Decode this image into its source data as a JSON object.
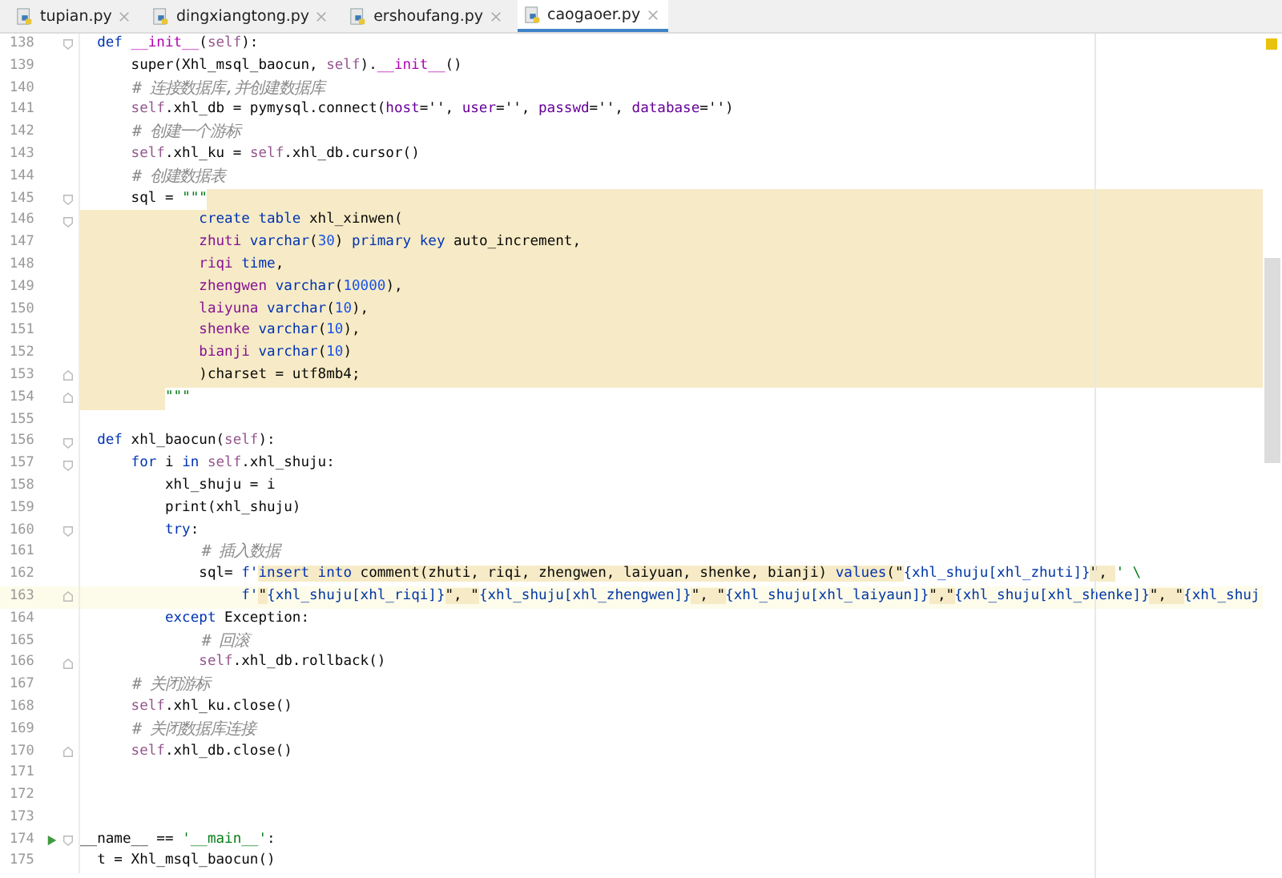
{
  "tabs": [
    {
      "label": "tupian.py",
      "selected": false
    },
    {
      "label": "dingxiangtong.py",
      "selected": false
    },
    {
      "label": "ershoufang.py",
      "selected": false
    },
    {
      "label": "caogaoer.py",
      "selected": true
    }
  ],
  "lines": [
    {
      "number": "138",
      "fold_open": true,
      "segments": [
        {
          "kind": "kw",
          "text": "  def "
        },
        {
          "kind": "dunder",
          "text": "__init__"
        },
        {
          "kind": "plain",
          "text": "("
        },
        {
          "kind": "self",
          "text": "self"
        },
        {
          "kind": "plain",
          "text": "):"
        }
      ]
    },
    {
      "number": "139",
      "segments": [
        {
          "kind": "plain",
          "text": "      super(Xhl_msql_baocun, "
        },
        {
          "kind": "self",
          "text": "self"
        },
        {
          "kind": "plain",
          "text": ")."
        },
        {
          "kind": "dunder",
          "text": "__init__"
        },
        {
          "kind": "plain",
          "text": "()"
        }
      ]
    },
    {
      "number": "140",
      "segments": [
        {
          "kind": "comment",
          "text": "      # 连接数据库,并创建数据库"
        }
      ]
    },
    {
      "number": "141",
      "segments": [
        {
          "kind": "self",
          "text": "      self"
        },
        {
          "kind": "plain",
          "text": ".xhl_db = pymysql.connect("
        },
        {
          "kind": "arg",
          "text": "host"
        },
        {
          "kind": "plain",
          "text": "='', "
        },
        {
          "kind": "arg",
          "text": "user"
        },
        {
          "kind": "plain",
          "text": "='', "
        },
        {
          "kind": "arg",
          "text": "passwd"
        },
        {
          "kind": "plain",
          "text": "='', "
        },
        {
          "kind": "arg",
          "text": "database"
        },
        {
          "kind": "plain",
          "text": "='')"
        }
      ]
    },
    {
      "number": "142",
      "segments": [
        {
          "kind": "comment",
          "text": "      # 创建一个游标"
        }
      ]
    },
    {
      "number": "143",
      "segments": [
        {
          "kind": "self",
          "text": "      self"
        },
        {
          "kind": "plain",
          "text": ".xhl_ku = "
        },
        {
          "kind": "self",
          "text": "self"
        },
        {
          "kind": "plain",
          "text": ".xhl_db.cursor()"
        }
      ]
    },
    {
      "number": "144",
      "segments": [
        {
          "kind": "comment",
          "text": "      # 创建数据表"
        }
      ]
    },
    {
      "number": "145",
      "fold_open": true,
      "fragment_after": true,
      "segments": [
        {
          "kind": "plain",
          "text": "      sql = "
        },
        {
          "kind": "string",
          "text": "\"\"\""
        }
      ]
    },
    {
      "number": "146",
      "fold_open": true,
      "fragment": true,
      "segments": [
        {
          "kind": "kw",
          "text": "              create table"
        },
        {
          "kind": "plain",
          "text": " xhl_xinwen("
        }
      ]
    },
    {
      "number": "147",
      "fragment": true,
      "segments": [
        {
          "kind": "column",
          "text": "              zhuti"
        },
        {
          "kind": "kw",
          "text": " varchar"
        },
        {
          "kind": "plain",
          "text": "("
        },
        {
          "kind": "num",
          "text": "30"
        },
        {
          "kind": "plain",
          "text": ") "
        },
        {
          "kind": "kw",
          "text": "primary key"
        },
        {
          "kind": "plain",
          "text": " auto_increment,"
        }
      ]
    },
    {
      "number": "148",
      "fragment": true,
      "segments": [
        {
          "kind": "column",
          "text": "              riqi"
        },
        {
          "kind": "kw",
          "text": " time"
        },
        {
          "kind": "plain",
          "text": ","
        }
      ]
    },
    {
      "number": "149",
      "fragment": true,
      "segments": [
        {
          "kind": "column",
          "text": "              zhengwen"
        },
        {
          "kind": "kw",
          "text": " varchar"
        },
        {
          "kind": "plain",
          "text": "("
        },
        {
          "kind": "num",
          "text": "10000"
        },
        {
          "kind": "plain",
          "text": "),"
        }
      ]
    },
    {
      "number": "150",
      "fragment": true,
      "segments": [
        {
          "kind": "column",
          "text": "              laiyuna"
        },
        {
          "kind": "kw",
          "text": " varchar"
        },
        {
          "kind": "plain",
          "text": "("
        },
        {
          "kind": "num",
          "text": "10"
        },
        {
          "kind": "plain",
          "text": "),"
        }
      ]
    },
    {
      "number": "151",
      "fragment": true,
      "segments": [
        {
          "kind": "column",
          "text": "              shenke"
        },
        {
          "kind": "kw",
          "text": " varchar"
        },
        {
          "kind": "plain",
          "text": "("
        },
        {
          "kind": "num",
          "text": "10"
        },
        {
          "kind": "plain",
          "text": "),"
        }
      ]
    },
    {
      "number": "152",
      "fragment": true,
      "segments": [
        {
          "kind": "column",
          "text": "              bianji"
        },
        {
          "kind": "kw",
          "text": " varchar"
        },
        {
          "kind": "plain",
          "text": "("
        },
        {
          "kind": "num",
          "text": "10"
        },
        {
          "kind": "plain",
          "text": ")"
        }
      ]
    },
    {
      "number": "153",
      "fold_close": true,
      "fragment": true,
      "segments": [
        {
          "kind": "plain",
          "text": "              )charset = utf8mb4;"
        }
      ]
    },
    {
      "number": "154",
      "fold_close": true,
      "fragment_before": true,
      "segments": [
        {
          "kind": "string",
          "text": "\"\"\""
        }
      ]
    },
    {
      "number": "155"
    },
    {
      "number": "156",
      "fold_open": true,
      "segments": [
        {
          "kind": "kw",
          "text": "  def"
        },
        {
          "kind": "plain",
          "text": " xhl_baocun("
        },
        {
          "kind": "self",
          "text": "self"
        },
        {
          "kind": "plain",
          "text": "):"
        }
      ]
    },
    {
      "number": "157",
      "fold_open": true,
      "segments": [
        {
          "kind": "kw",
          "text": "      for"
        },
        {
          "kind": "plain",
          "text": " i "
        },
        {
          "kind": "kw",
          "text": "in"
        },
        {
          "kind": "self",
          "text": " self"
        },
        {
          "kind": "plain",
          "text": ".xhl_shuju:"
        }
      ]
    },
    {
      "number": "158",
      "segments": [
        {
          "kind": "plain",
          "text": "          xhl_shuju = i"
        }
      ]
    },
    {
      "number": "159",
      "segments": [
        {
          "kind": "plain",
          "text": "          print(xhl_shuju)"
        }
      ]
    },
    {
      "number": "160",
      "fold_open": true,
      "segments": [
        {
          "kind": "kw",
          "text": "          try"
        },
        {
          "kind": "plain",
          "text": ":"
        }
      ]
    },
    {
      "number": "161",
      "segments": [
        {
          "kind": "comment",
          "text": "              # 插入数据"
        }
      ]
    },
    {
      "number": "162",
      "segments": [
        {
          "kind": "plain",
          "text": "              sql= "
        },
        {
          "kind": "kw",
          "text": "f'"
        },
        {
          "kind": "kw",
          "text": "insert into",
          "injected": true
        },
        {
          "kind": "plain",
          "text": " comment(zhuti, riqi, zhengwen, laiyuan, shenke, bianji) ",
          "injected": true
        },
        {
          "kind": "kw",
          "text": "values",
          "injected": true
        },
        {
          "kind": "plain",
          "text": "(\"",
          "injected": true
        },
        {
          "kind": "fx",
          "text": "{xhl_shuju[xhl_zhuti]}"
        },
        {
          "kind": "plain",
          "text": "\", ",
          "injected": true
        },
        {
          "kind": "string",
          "text": "' \\"
        }
      ]
    },
    {
      "number": "163",
      "fold_close": true,
      "current": true,
      "segments": [
        {
          "kind": "kw",
          "text": "                   f'"
        },
        {
          "kind": "plain",
          "text": "\"",
          "injected": true
        },
        {
          "kind": "fx",
          "text": "{xhl_shuju[xhl_riqi]}"
        },
        {
          "kind": "plain",
          "text": "\", \"",
          "injected": true
        },
        {
          "kind": "fx",
          "text": "{xhl_shuju[xhl_zhengwen]}"
        },
        {
          "kind": "plain",
          "text": "\", \"",
          "injected": true
        },
        {
          "kind": "fx",
          "text": "{xhl_shuju[xhl_laiyaun]}"
        },
        {
          "kind": "plain",
          "text": "\",\"",
          "injected": true
        },
        {
          "kind": "fx",
          "text": "{xhl_shuju[xhl_shenke]}"
        },
        {
          "kind": "plain",
          "text": "\", \"",
          "injected": true
        },
        {
          "kind": "fx",
          "text": "{xhl_shuj"
        }
      ]
    },
    {
      "number": "164",
      "segments": [
        {
          "kind": "kw",
          "text": "          except"
        },
        {
          "kind": "plain",
          "text": " Exception:"
        }
      ]
    },
    {
      "number": "165",
      "segments": [
        {
          "kind": "comment",
          "text": "              # 回滚"
        }
      ]
    },
    {
      "number": "166",
      "fold_close": true,
      "segments": [
        {
          "kind": "self",
          "text": "              self"
        },
        {
          "kind": "plain",
          "text": ".xhl_db.rollback()"
        }
      ]
    },
    {
      "number": "167",
      "segments": [
        {
          "kind": "comment",
          "text": "      # 关闭游标"
        }
      ]
    },
    {
      "number": "168",
      "segments": [
        {
          "kind": "self",
          "text": "      self"
        },
        {
          "kind": "plain",
          "text": ".xhl_ku.close()"
        }
      ]
    },
    {
      "number": "169",
      "segments": [
        {
          "kind": "comment",
          "text": "      # 关闭数据库连接"
        }
      ]
    },
    {
      "number": "170",
      "fold_close": true,
      "segments": [
        {
          "kind": "self",
          "text": "      self"
        },
        {
          "kind": "plain",
          "text": ".xhl_db.close()"
        }
      ]
    },
    {
      "number": "171"
    },
    {
      "number": "172"
    },
    {
      "number": "173"
    },
    {
      "number": "174",
      "fold_open": true,
      "runnable": true,
      "segments": [
        {
          "kind": "plain",
          "text": "__name__ == "
        },
        {
          "kind": "string",
          "text": "'__main__'"
        },
        {
          "kind": "plain",
          "text": ":"
        }
      ]
    },
    {
      "number": "175",
      "segments": [
        {
          "kind": "plain",
          "text": "  t = Xhl_msql_baocun()"
        }
      ]
    }
  ]
}
